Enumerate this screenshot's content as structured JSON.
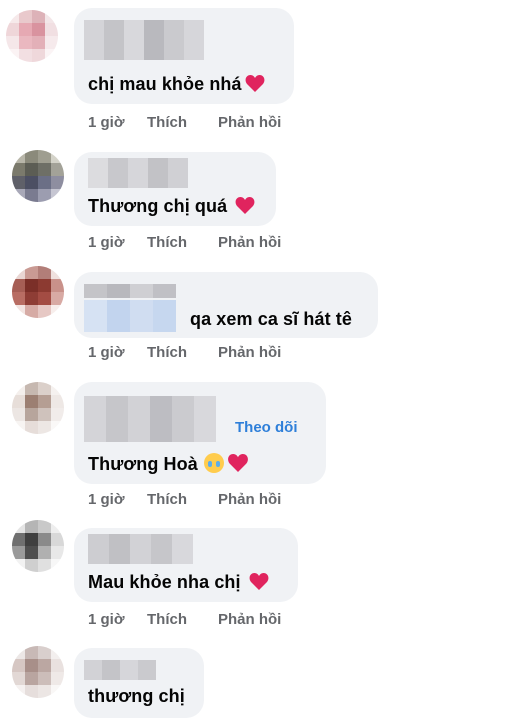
{
  "comments": [
    {
      "text": "chị mau khỏe nhá",
      "time": "1 giờ",
      "like": "Thích",
      "reply": "Phản hồi",
      "emoji": [
        "heart"
      ]
    },
    {
      "text": "Thương chị quá",
      "time": "1 giờ",
      "like": "Thích",
      "reply": "Phản hồi",
      "emoji": [
        "heart"
      ]
    },
    {
      "text": "qa xem ca sĩ hát tê",
      "time": "1 giờ",
      "like": "Thích",
      "reply": "Phản hồi",
      "emoji": []
    },
    {
      "text": "Thương Hoà",
      "time": "1 giờ",
      "like": "Thích",
      "reply": "Phản hồi",
      "follow": "Theo dõi",
      "emoji": [
        "crying-face",
        "heart"
      ]
    },
    {
      "text": "Mau khỏe nha chị",
      "time": "1 giờ",
      "like": "Thích",
      "reply": "Phản hồi",
      "emoji": [
        "heart"
      ]
    },
    {
      "text": "thương chị"
    }
  ],
  "colors": {
    "bubble": "#f0f2f5",
    "action_text": "#65676b",
    "follow_link": "#2e7fd9",
    "heart": "#e0245e"
  }
}
